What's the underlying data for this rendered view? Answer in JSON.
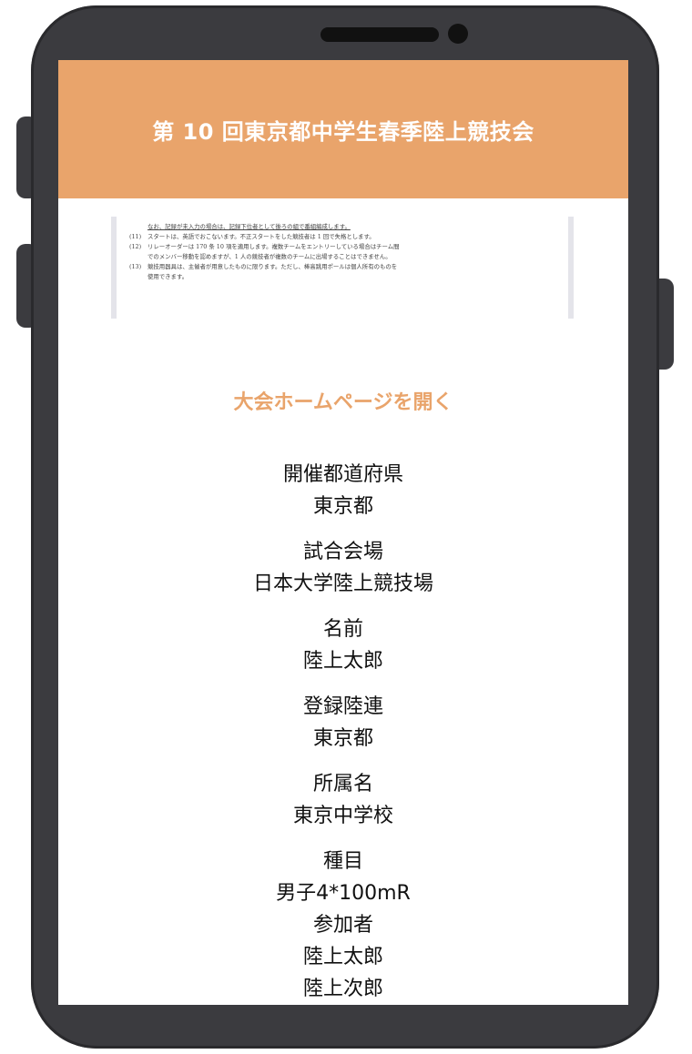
{
  "header": {
    "title": "第 10 回東京都中学生春季陸上競技会"
  },
  "document_excerpt": {
    "lines": [
      {
        "num": "",
        "text": "なお、記録が未入力の場合は、記録下位者として後ろの組で番組編成します。"
      },
      {
        "num": "(11)",
        "text": "スタートは、英語でおこないます。不正スタートをした競技者は 1 回で失格とします。"
      },
      {
        "num": "(12)",
        "text": "リレーオーダーは 170 条 10 項を適用します。複数チームをエントリーしている場合はチーム間"
      },
      {
        "num": "",
        "text": "でのメンバー移動を認めますが、1 人の競技者が複数のチームに出場することはできません。"
      },
      {
        "num": "(13)",
        "text": "競技用器具は、主催者が用意したものに限ります。ただし、棒高跳用ポールは個人所有のものを"
      },
      {
        "num": "",
        "text": "使用できます。"
      }
    ]
  },
  "open_homepage_label": "大会ホームページを開く",
  "fields": [
    {
      "label": "開催都道府県",
      "values": [
        "東京都"
      ]
    },
    {
      "label": "試合会場",
      "values": [
        "日本大学陸上競技場"
      ]
    },
    {
      "label": "名前",
      "values": [
        "陸上太郎"
      ]
    },
    {
      "label": "登録陸連",
      "values": [
        "東京都"
      ]
    },
    {
      "label": "所属名",
      "values": [
        "東京中学校"
      ]
    },
    {
      "label": "種目",
      "values": [
        "男子4*100mR"
      ]
    },
    {
      "label": "参加者",
      "values": [
        "陸上太郎",
        "陸上次郎"
      ]
    }
  ],
  "colors": {
    "accent": "#e9a46b",
    "phone_frame": "#3b3b3f"
  }
}
